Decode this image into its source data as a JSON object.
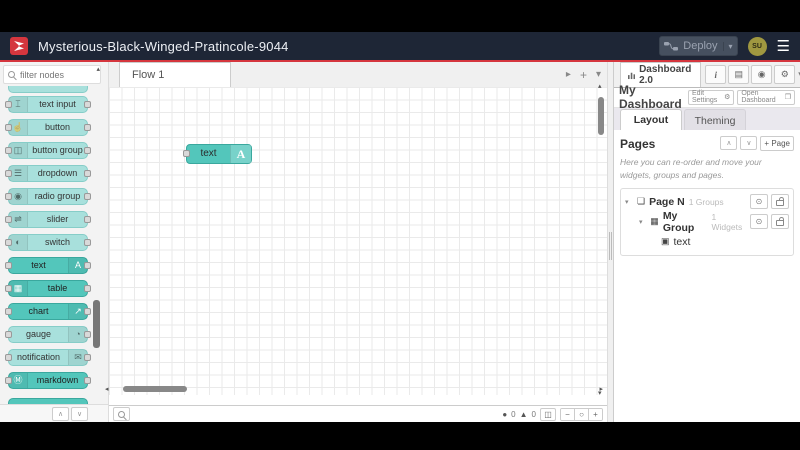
{
  "colors": {
    "accent_red": "#d5363e",
    "header_bg": "#1e2636",
    "teal_light": "#a8e0dc",
    "teal_dark": "#53c6bb"
  },
  "header": {
    "title": "Mysterious-Black-Winged-Pratincole-9044",
    "deploy_label": "Deploy",
    "avatar_label": "SU"
  },
  "palette": {
    "filter_placeholder": "filter nodes",
    "nodes": [
      {
        "label": "text input",
        "variant": "light",
        "icon": "text-cursor-icon",
        "glyph": "⌶",
        "icon_side": "left"
      },
      {
        "label": "button",
        "variant": "light",
        "icon": "pointer-hand-icon",
        "glyph": "☝",
        "icon_side": "left"
      },
      {
        "label": "button group",
        "variant": "light",
        "icon": "button-group-icon",
        "glyph": "◫",
        "icon_side": "left"
      },
      {
        "label": "dropdown",
        "variant": "light",
        "icon": "dropdown-list-icon",
        "glyph": "☰",
        "icon_side": "left"
      },
      {
        "label": "radio group",
        "variant": "light",
        "icon": "radio-icon",
        "glyph": "◉",
        "icon_side": "left"
      },
      {
        "label": "slider",
        "variant": "light",
        "icon": "slider-icon",
        "glyph": "⇌",
        "icon_side": "left"
      },
      {
        "label": "switch",
        "variant": "light",
        "icon": "switch-toggle-icon",
        "glyph": "◐",
        "icon_side": "left"
      },
      {
        "label": "text",
        "variant": "dark",
        "icon": "text-a-icon",
        "glyph": "A",
        "icon_side": "right"
      },
      {
        "label": "table",
        "variant": "dark",
        "icon": "table-grid-icon",
        "glyph": "▦",
        "icon_side": "left"
      },
      {
        "label": "chart",
        "variant": "dark",
        "icon": "chart-line-icon",
        "glyph": "↗",
        "icon_side": "right"
      },
      {
        "label": "gauge",
        "variant": "light",
        "icon": "gauge-icon",
        "glyph": "◔",
        "icon_side": "right"
      },
      {
        "label": "notification",
        "variant": "light",
        "icon": "envelope-icon",
        "glyph": "✉",
        "icon_side": "right"
      },
      {
        "label": "markdown",
        "variant": "dark",
        "icon": "markdown-icon",
        "glyph": "Ⓜ",
        "icon_side": "left"
      }
    ]
  },
  "workspace": {
    "tab_label": "Flow 1",
    "node_label": "text",
    "node_icon_glyph": "A"
  },
  "footer": {
    "error_count": "0",
    "warning_count": "0"
  },
  "sidebar": {
    "tab_label": "Dashboard 2.0",
    "dashboard_title": "My Dashboard",
    "edit_settings_label": "Edit Settings",
    "open_dashboard_label": "Open Dashboard",
    "tab_layout": "Layout",
    "tab_theming": "Theming",
    "pages_heading": "Pages",
    "add_page_label": "+ Page",
    "description": "Here you can re-order and move your widgets, groups and pages.",
    "tree": {
      "page": {
        "label": "Page N",
        "meta": "1 Groups"
      },
      "group": {
        "label": "My Group",
        "meta": "1 Widgets"
      },
      "widget": {
        "label": "text"
      }
    }
  },
  "icons": {
    "hamburger": "☰",
    "caret_down": "▾",
    "plus": "+",
    "arrow_right": "▸",
    "scroll_up": "▴",
    "scroll_down": "▾",
    "scroll_left": "◂",
    "chevron_up": "∧",
    "chevron_down": "∨",
    "info": "i",
    "help_book": "▤",
    "debug_bug": "◉",
    "gear": "⚙",
    "external_link": "❐",
    "error_circle": "●",
    "warning_triangle": "▲",
    "navigator": "◫",
    "zoom_out": "−",
    "zoom_reset": "○",
    "zoom_in": "+",
    "tree_caret": "▾",
    "page_frame": "❏",
    "group_grid": "▦",
    "image": "▣",
    "eye": "⊙"
  }
}
